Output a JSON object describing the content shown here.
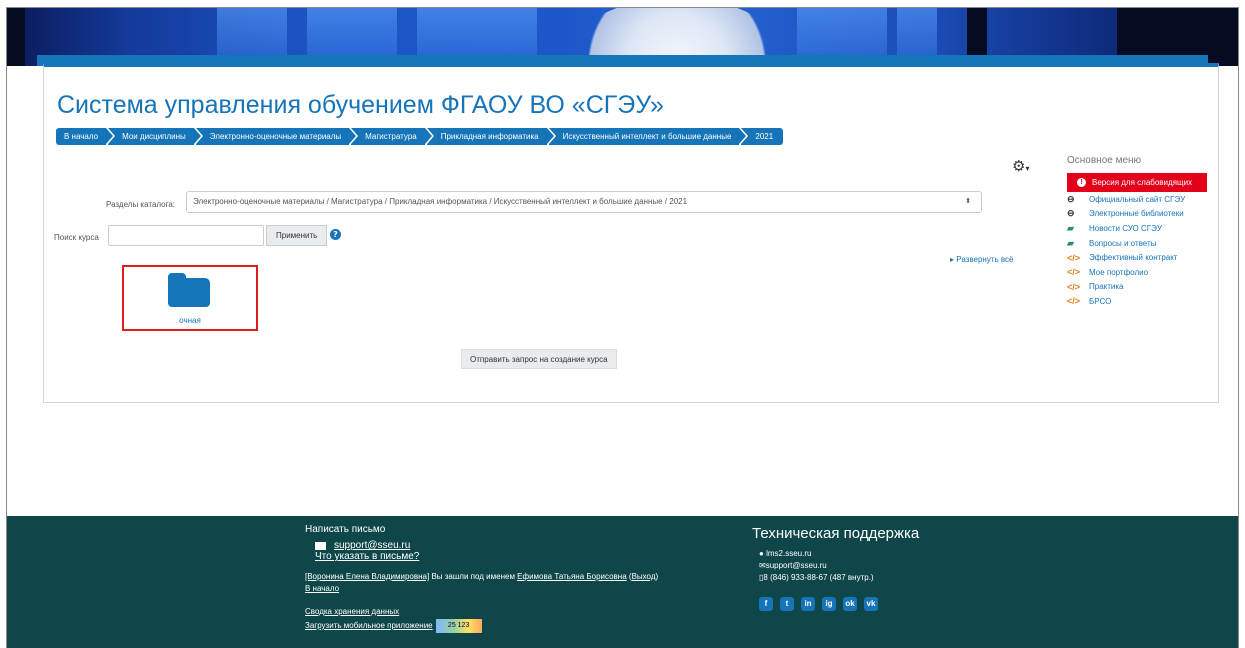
{
  "site_title": "Система управления обучением ФГАОУ ВО «СГЭУ»",
  "breadcrumbs": [
    "В начало",
    "Мои дисциплины",
    "Электронно-оценочные материалы",
    "Магистратура",
    "Прикладная информатика",
    "Искусственный интеллект и большие данные",
    "2021"
  ],
  "catalog": {
    "label": "Разделы каталога:",
    "selected": "Электронно-оценочные материалы / Магистратура / Прикладная информатика / Искусственный интеллект и большие данные / 2021"
  },
  "search": {
    "label": "Поиск курса",
    "value": "",
    "apply_label": "Применить"
  },
  "expand_all": "Развернуть всё",
  "category": {
    "name": "очная"
  },
  "request_button": "Отправить запрос на создание курса",
  "sidebar": {
    "title": "Основное меню",
    "accessibility_button": "Версия для слабовидящих",
    "items": [
      {
        "label": "Официальный сайт СГЭУ",
        "icon": "link-icon"
      },
      {
        "label": "Электронные библиотеки",
        "icon": "link-icon"
      },
      {
        "label": "Новости СУО СГЭУ",
        "icon": "chat-icon"
      },
      {
        "label": "Вопросы и ответы",
        "icon": "chat-icon"
      },
      {
        "label": "Эффективный контракт",
        "icon": "code-icon"
      },
      {
        "label": "Мое портфолио",
        "icon": "code-icon"
      },
      {
        "label": "Практика",
        "icon": "code-icon"
      },
      {
        "label": "БРСО",
        "icon": "code-icon"
      }
    ]
  },
  "footer": {
    "write_heading": "Написать письмо",
    "email": "support@sseu.ru",
    "what_to_write": "Что указать в письме?",
    "login_user": "[Воронина Елена Владимировна]",
    "login_mid": " Вы зашли под именем ",
    "login_as": "Ефимова Татьяна Борисовна",
    "logout": "Выход",
    "home": "В начало",
    "data_retention": "Сводка хранения данных",
    "mobile_app": "Загрузить мобильное приложение",
    "counter": "25 123",
    "support_heading": "Техническая поддержка",
    "support_site": "lms2.sseu.ru",
    "support_email": "support@sseu.ru",
    "support_phone": "8 (846) 933-88-67 (487 внутр.)",
    "socials": [
      "f",
      "t",
      "in",
      "ig",
      "ok",
      "vk"
    ]
  }
}
